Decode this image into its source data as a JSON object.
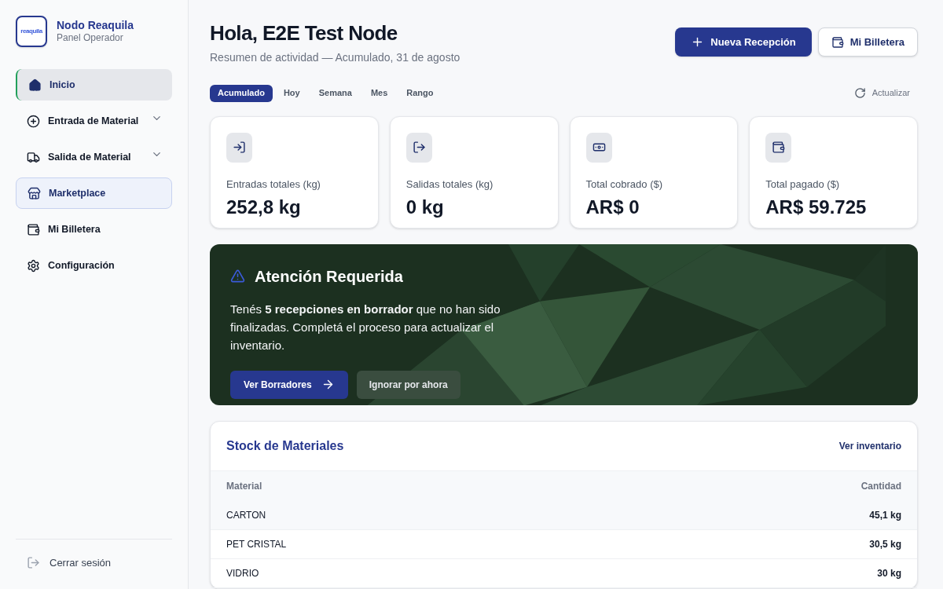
{
  "sidebar": {
    "logo_text": "reaquila",
    "title": "Nodo Reaquila",
    "subtitle": "Panel Operador",
    "items": [
      {
        "label": "Inicio",
        "selected": true
      },
      {
        "label": "Entrada de Material",
        "selected": false,
        "expanded": false
      },
      {
        "label": "Salida de Material",
        "selected": false,
        "expanded": false
      },
      {
        "label": "Marketplace",
        "selected": false,
        "highlighted": true
      },
      {
        "label": "Mi Billetera",
        "selected": false
      },
      {
        "label": "Configuración",
        "selected": false
      }
    ],
    "logout": "Cerrar sesión"
  },
  "header": {
    "title": "Hola, E2E Test Node",
    "subtitle": "Resumen de actividad — Acumulado, 31 de agosto",
    "primary_button": "Nueva Recepción",
    "secondary_button": "Mi Billetera"
  },
  "tabs": [
    {
      "label": "Acumulado",
      "selected": true
    },
    {
      "label": "Hoy",
      "selected": false
    },
    {
      "label": "Semana",
      "selected": false
    },
    {
      "label": "Mes",
      "selected": false
    },
    {
      "label": "Rango",
      "selected": false
    }
  ],
  "refresh": "Actualizar",
  "stats": [
    {
      "label": "Entradas totales (kg)",
      "value": "252,8 kg"
    },
    {
      "label": "Salidas totales (kg)",
      "value": "0 kg"
    },
    {
      "label": "Total cobrado ($)",
      "value": "AR$ 0"
    },
    {
      "label": "Total pagado ($)",
      "value": "AR$ 59.725"
    }
  ],
  "alert": {
    "title": "Atención Requerida",
    "message": "Tenés **5 recepciones en borrador** que no han sido finalizadas. Completá el proceso para actualizar el inventario.",
    "primary_button": "Ver Borradores",
    "secondary_button": "Ignorar por ahora"
  },
  "stock": {
    "title": "Stock de Materiales",
    "link": "Ver inventario",
    "columns": [
      "Material",
      "Cantidad"
    ],
    "rows": [
      [
        "CARTON",
        "45,1 kg"
      ],
      [
        "PET CRISTAL",
        "30,5 kg"
      ],
      [
        "VIDRIO",
        "30 kg"
      ]
    ]
  }
}
